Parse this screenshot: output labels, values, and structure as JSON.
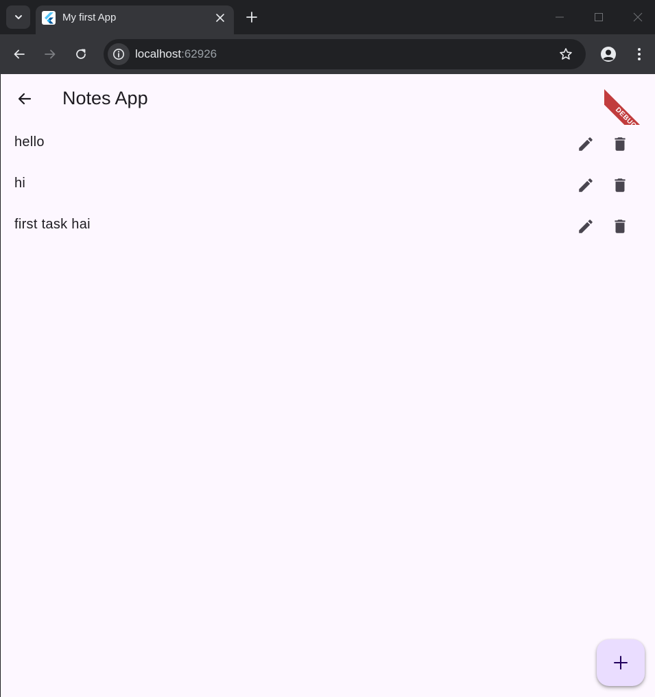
{
  "browser": {
    "tab": {
      "title": "My first App"
    },
    "address": {
      "host": "localhost",
      "port": ":62926"
    }
  },
  "app": {
    "title": "Notes App",
    "debug_label": "DEBUG",
    "notes": [
      {
        "text": "hello"
      },
      {
        "text": "hi"
      },
      {
        "text": "first task hai"
      }
    ],
    "colors": {
      "background": "#fdf7ff",
      "fab": "#eaddff",
      "icon": "#49454f",
      "text": "#1d1b20"
    }
  },
  "icons": {
    "tab_search": "chevron-down-icon",
    "favicon": "flutter-logo-icon",
    "tab_close": "close-icon",
    "new_tab": "plus-icon",
    "back": "arrow-left-icon",
    "forward": "arrow-right-icon",
    "reload": "reload-icon",
    "site_info": "info-icon",
    "bookmark": "star-icon",
    "profile": "account-icon",
    "menu": "kebab-menu-icon",
    "edit": "pencil-icon",
    "delete": "trash-icon",
    "fab": "plus-icon"
  }
}
